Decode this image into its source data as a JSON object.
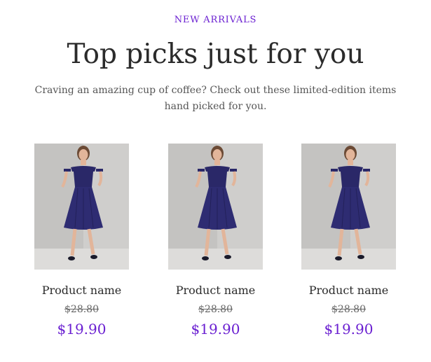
{
  "section": {
    "eyebrow": "NEW ARRIVALS",
    "title": "Top picks just for you",
    "subtitle": "Craving an amazing cup of coffee? Check out these limited-edition items hand picked for you."
  },
  "products": [
    {
      "name": "Product name",
      "original_price": "$28.80",
      "sale_price": "$19.90",
      "image": "navy-dress-photo"
    },
    {
      "name": "Product name",
      "original_price": "$28.80",
      "sale_price": "$19.90",
      "image": "navy-dress-photo"
    },
    {
      "name": "Product name",
      "original_price": "$28.80",
      "sale_price": "$19.90",
      "image": "navy-dress-photo"
    }
  ],
  "colors": {
    "accent": "#6a1fd1",
    "dress": "#2a2868",
    "backdrop": "#c9c8c6"
  }
}
